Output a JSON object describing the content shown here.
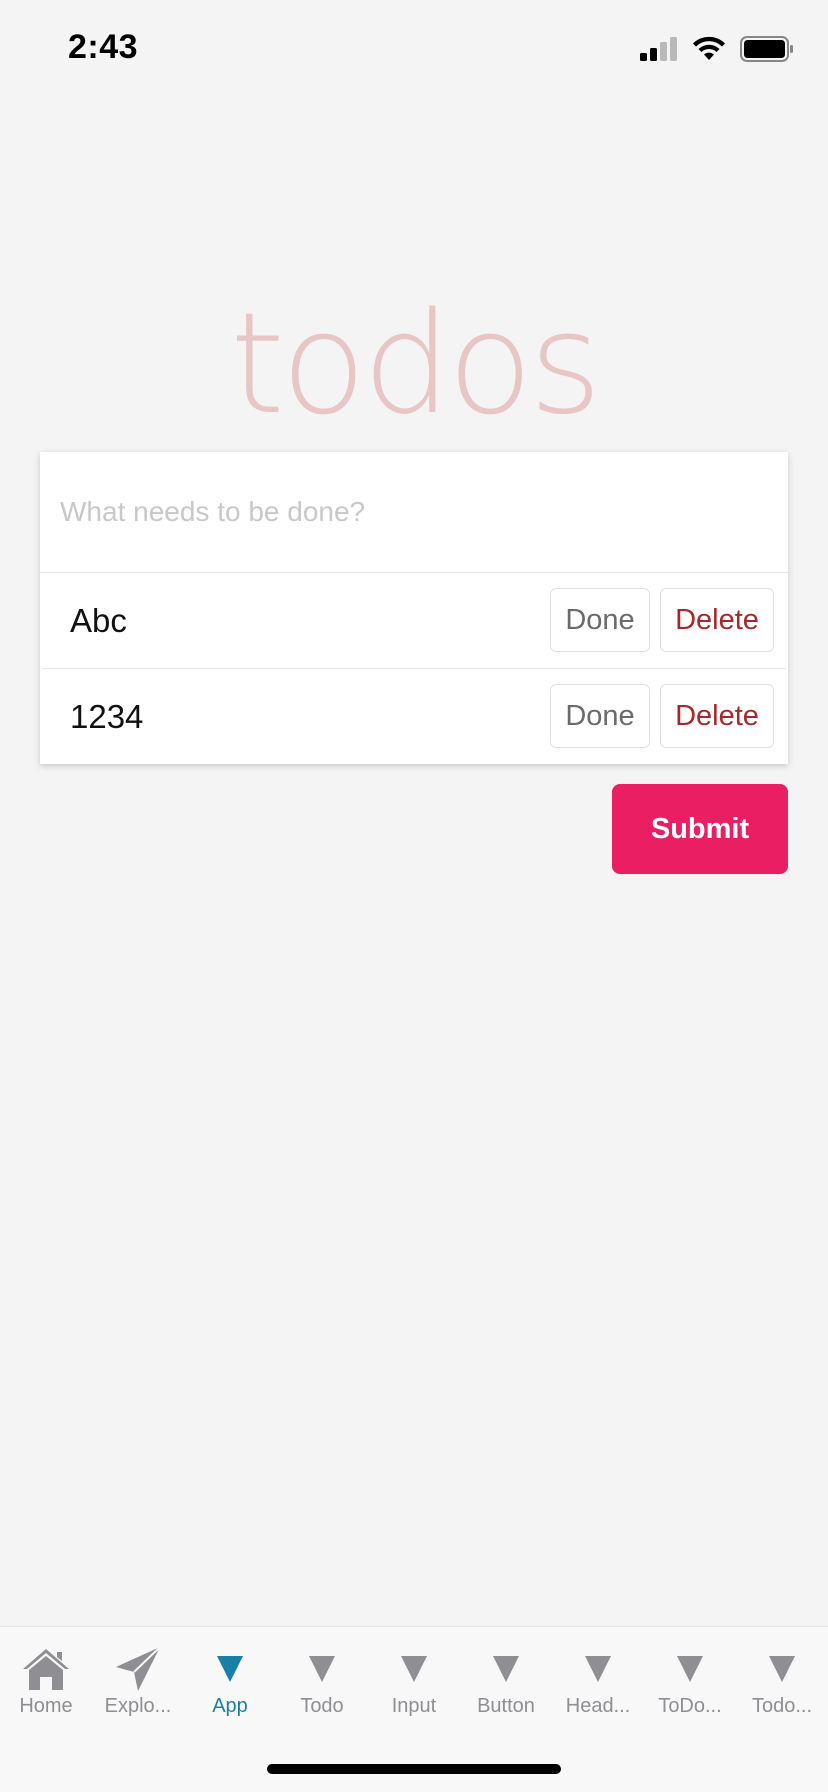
{
  "status_bar": {
    "time": "2:43"
  },
  "title": "todos",
  "input": {
    "placeholder": "What needs to be done?",
    "value": ""
  },
  "todos": [
    {
      "text": "Abc",
      "done_label": "Done",
      "delete_label": "Delete"
    },
    {
      "text": "1234",
      "done_label": "Done",
      "delete_label": "Delete"
    }
  ],
  "submit_label": "Submit",
  "tab_bar": {
    "active_tab": "App",
    "tabs": [
      {
        "label": "Home",
        "icon": "home-icon"
      },
      {
        "label": "Explo...",
        "icon": "paper-plane-icon"
      },
      {
        "label": "App",
        "icon": "triangle-down-icon"
      },
      {
        "label": "Todo",
        "icon": "triangle-down-icon"
      },
      {
        "label": "Input",
        "icon": "triangle-down-icon"
      },
      {
        "label": "Button",
        "icon": "triangle-down-icon"
      },
      {
        "label": "Head...",
        "icon": "triangle-down-icon"
      },
      {
        "label": "ToDo...",
        "icon": "triangle-down-icon"
      },
      {
        "label": "Todo...",
        "icon": "triangle-down-icon"
      }
    ]
  },
  "colors": {
    "background": "#f4f4f4",
    "title": "#e8c6c6",
    "submit": "#e91e63",
    "delete_text": "#a9262b",
    "active_tab": "#1a7fa6",
    "inactive_tab": "#8e8e93"
  }
}
